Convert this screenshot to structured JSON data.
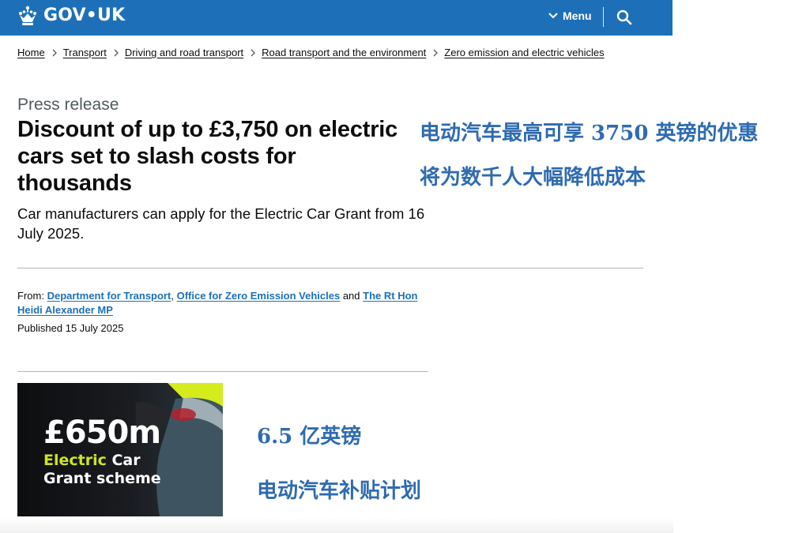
{
  "header": {
    "logo_text": "GOV•UK",
    "menu_label": "Menu",
    "brand_color": "#1d70b8",
    "icons": [
      "crown-icon",
      "chevron-down-icon",
      "search-icon"
    ]
  },
  "breadcrumb": [
    {
      "label": "Home"
    },
    {
      "label": "Transport"
    },
    {
      "label": "Driving and road transport"
    },
    {
      "label": "Road transport and the environment"
    },
    {
      "label": "Zero emission and electric vehicles"
    }
  ],
  "article": {
    "caption": "Press release",
    "title": "Discount of up to £3,750 on electric cars set to slash costs for thousands",
    "lead": "Car manufacturers can apply for the Electric Car Grant from 16 July 2025.",
    "from_label": "From:",
    "orgs": [
      "Department for Transport",
      "Office for Zero Emission Vehicles",
      "The Rt Hon Heidi Alexander MP"
    ],
    "separator_comma": ",",
    "separator_and": "and",
    "published": "Published 15 July 2025"
  },
  "hero_image": {
    "big_text": "£650m",
    "line2_highlight": "Electric",
    "line2_rest": " Car",
    "line3": "Grant scheme",
    "highlight_color": "#cfe51f"
  },
  "overlay_cn": {
    "title_line1": "电动汽车最高可享 3750 英镑的优惠",
    "title_line2": "将为数千人大幅降低成本",
    "amount": "6.5 亿英镑",
    "scheme": "电动汽车补贴计划",
    "color": "#2f6bb0"
  }
}
